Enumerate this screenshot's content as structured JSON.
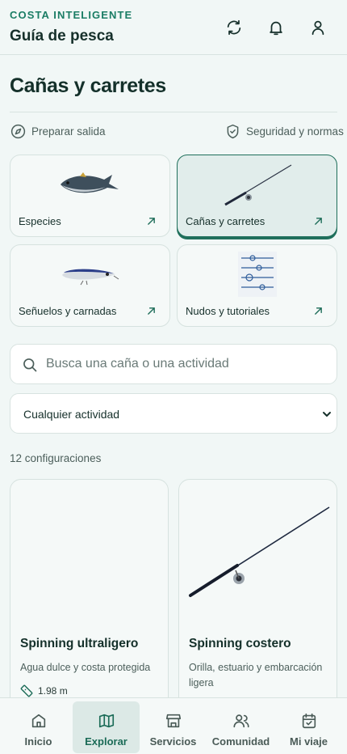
{
  "header": {
    "brand": "COSTA INTELIGENTE",
    "title": "Guía de pesca"
  },
  "page": {
    "title": "Cañas y carretes"
  },
  "quick_links": {
    "prepare": "Preparar salida",
    "safety": "Seguridad y normas"
  },
  "categories": [
    {
      "label": "Especies",
      "icon": "tuna-image",
      "active": false
    },
    {
      "label": "Cañas y carretes",
      "icon": "rod-image",
      "active": true
    },
    {
      "label": "Señuelos y carnadas",
      "icon": "lure-image",
      "active": false
    },
    {
      "label": "Nudos y tutoriales",
      "icon": "knots-image",
      "active": false
    }
  ],
  "search": {
    "placeholder": "Busca una caña o una actividad",
    "value": ""
  },
  "activity_filter": {
    "selected": "Cualquier actividad"
  },
  "results": {
    "count_text": "12 configuraciones"
  },
  "rods": [
    {
      "name": "Spinning ultraligero",
      "description": "Agua dulce y costa protegida",
      "length": "1.98 m"
    },
    {
      "name": "Spinning costero",
      "description": "Orilla, estuario y embarcación ligera",
      "length": ""
    }
  ],
  "bottom_nav": [
    {
      "label": "Inicio",
      "icon": "home-icon",
      "active": false
    },
    {
      "label": "Explorar",
      "icon": "map-icon",
      "active": true
    },
    {
      "label": "Servicios",
      "icon": "store-icon",
      "active": false
    },
    {
      "label": "Comunidad",
      "icon": "people-icon",
      "active": false
    },
    {
      "label": "Mi viaje",
      "icon": "calendar-check-icon",
      "active": false
    }
  ],
  "colors": {
    "brand": "#1b7d65",
    "background": "#f1f7f6",
    "active_border": "#1f6f5b",
    "text": "#16302b"
  }
}
